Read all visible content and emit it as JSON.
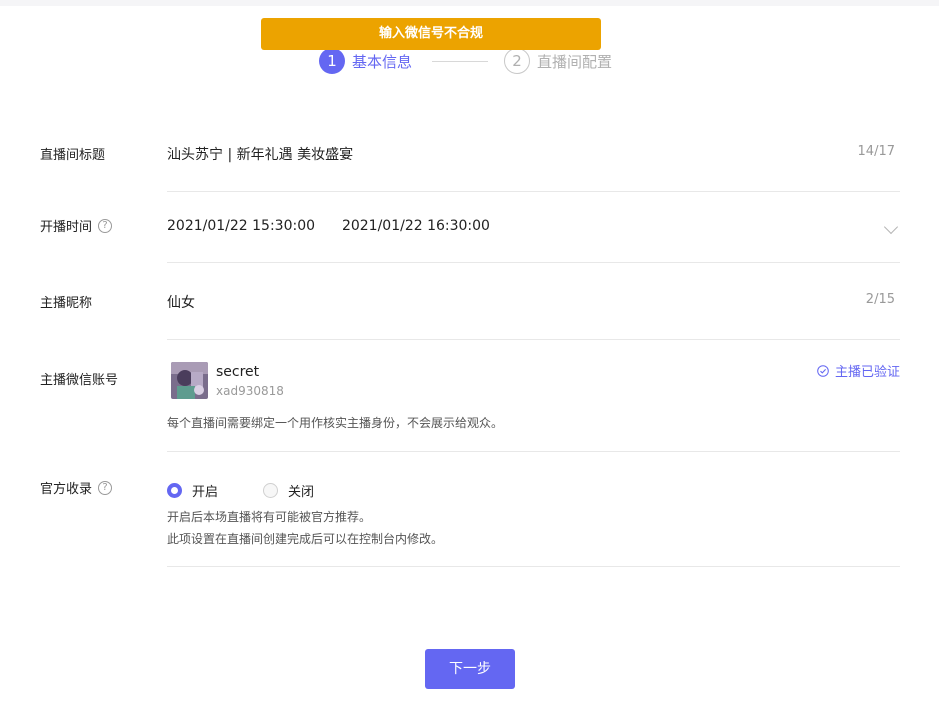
{
  "toast": {
    "message": "输入微信号不合规"
  },
  "steps": [
    {
      "number": "1",
      "label": "基本信息",
      "active": true
    },
    {
      "number": "2",
      "label": "直播间配置",
      "active": false
    }
  ],
  "form": {
    "title": {
      "label": "直播间标题",
      "value": "汕头苏宁 | 新年礼遇 美妆盛宴",
      "counter": "14/17"
    },
    "time": {
      "label": "开播时间",
      "start": "2021/01/22 15:30:00",
      "end": "2021/01/22 16:30:00"
    },
    "nickname": {
      "label": "主播昵称",
      "value": "仙女",
      "counter": "2/15"
    },
    "wechat": {
      "label": "主播微信账号",
      "name": "secret",
      "id": "xad930818",
      "verified_label": "主播已验证",
      "hint": "每个直播间需要绑定一个用作核实主播身份，不会展示给观众。"
    },
    "official": {
      "label": "官方收录",
      "options": [
        {
          "label": "开启",
          "selected": true
        },
        {
          "label": "关闭",
          "selected": false
        }
      ],
      "hint_line1": "开启后本场直播将有可能被官方推荐。",
      "hint_line2": "此项设置在直播间创建完成后可以在控制台内修改。"
    }
  },
  "actions": {
    "next_label": "下一步"
  },
  "colors": {
    "accent": "#6467f2",
    "toast": "#eca300",
    "divider": "#e8e8e8"
  },
  "icons": {
    "help": "question-circle-icon",
    "dropdown": "chevron-down-icon",
    "verified": "check-circle-icon"
  }
}
